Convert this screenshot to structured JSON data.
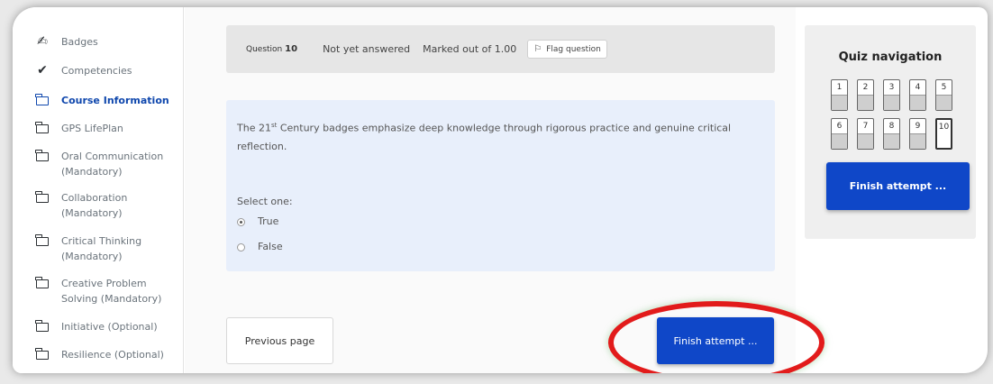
{
  "sidebar": {
    "items": [
      {
        "label": "Badges",
        "icon": "badge-icon",
        "active": false
      },
      {
        "label": "Competencies",
        "icon": "check-icon",
        "active": false
      },
      {
        "label": "Course Information",
        "icon": "folder-icon",
        "active": true
      },
      {
        "label": "GPS LifePlan",
        "icon": "folder-icon",
        "active": false
      },
      {
        "label": "Oral Communication (Mandatory)",
        "icon": "folder-icon",
        "active": false
      },
      {
        "label": "Collaboration (Mandatory)",
        "icon": "folder-icon",
        "active": false
      },
      {
        "label": "Critical Thinking (Mandatory)",
        "icon": "folder-icon",
        "active": false
      },
      {
        "label": "Creative Problem Solving (Mandatory)",
        "icon": "folder-icon",
        "active": false
      },
      {
        "label": "Initiative (Optional)",
        "icon": "folder-icon",
        "active": false
      },
      {
        "label": "Resilience (Optional)",
        "icon": "folder-icon",
        "active": false
      }
    ]
  },
  "question": {
    "label": "Question",
    "number": "10",
    "state": "Not yet answered",
    "marks": "Marked out of 1.00",
    "flag_label": "Flag question",
    "text_before_sup": "The 21",
    "sup": "st",
    "text_after_sup": " Century badges emphasize deep knowledge through rigorous practice and genuine critical reflection.",
    "prompt": "Select one:",
    "options": [
      {
        "label": "True",
        "selected": true
      },
      {
        "label": "False",
        "selected": false
      }
    ]
  },
  "actions": {
    "previous_label": "Previous page",
    "finish_label": "Finish attempt ..."
  },
  "quiz_nav": {
    "title": "Quiz navigation",
    "questions": [
      "1",
      "2",
      "3",
      "4",
      "5",
      "6",
      "7",
      "8",
      "9",
      "10"
    ],
    "current": "10",
    "finish_label": "Finish attempt ..."
  },
  "colors": {
    "accent": "#0f47c8",
    "highlight": "#e21b1b"
  }
}
